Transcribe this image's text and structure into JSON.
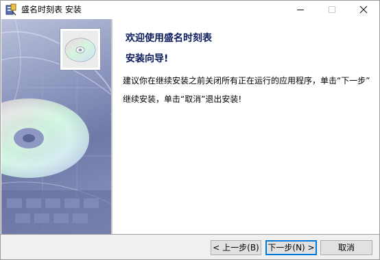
{
  "window": {
    "title": "盛名时刻表  安装"
  },
  "titlebar_buttons": {
    "minimize": "—",
    "maximize": "☐",
    "close": "✕"
  },
  "content": {
    "welcome": "欢迎使用盛名时刻表",
    "subtitle": "安装向导!",
    "body_line1": "建议你在继续安装之前关闭所有正在运行的应用程序，单击“下一步”",
    "body_line2": "继续安装，单击“取消”退出安装!"
  },
  "buttons": {
    "back": "< 上一步(B)",
    "next": "下一步(N) >",
    "cancel": "取消"
  },
  "icons": {
    "app": "installer-app-icon",
    "side_image": "cd-disc-graphic"
  },
  "colors": {
    "heading": "#0b1a5c",
    "focus_border": "#0078d7"
  }
}
